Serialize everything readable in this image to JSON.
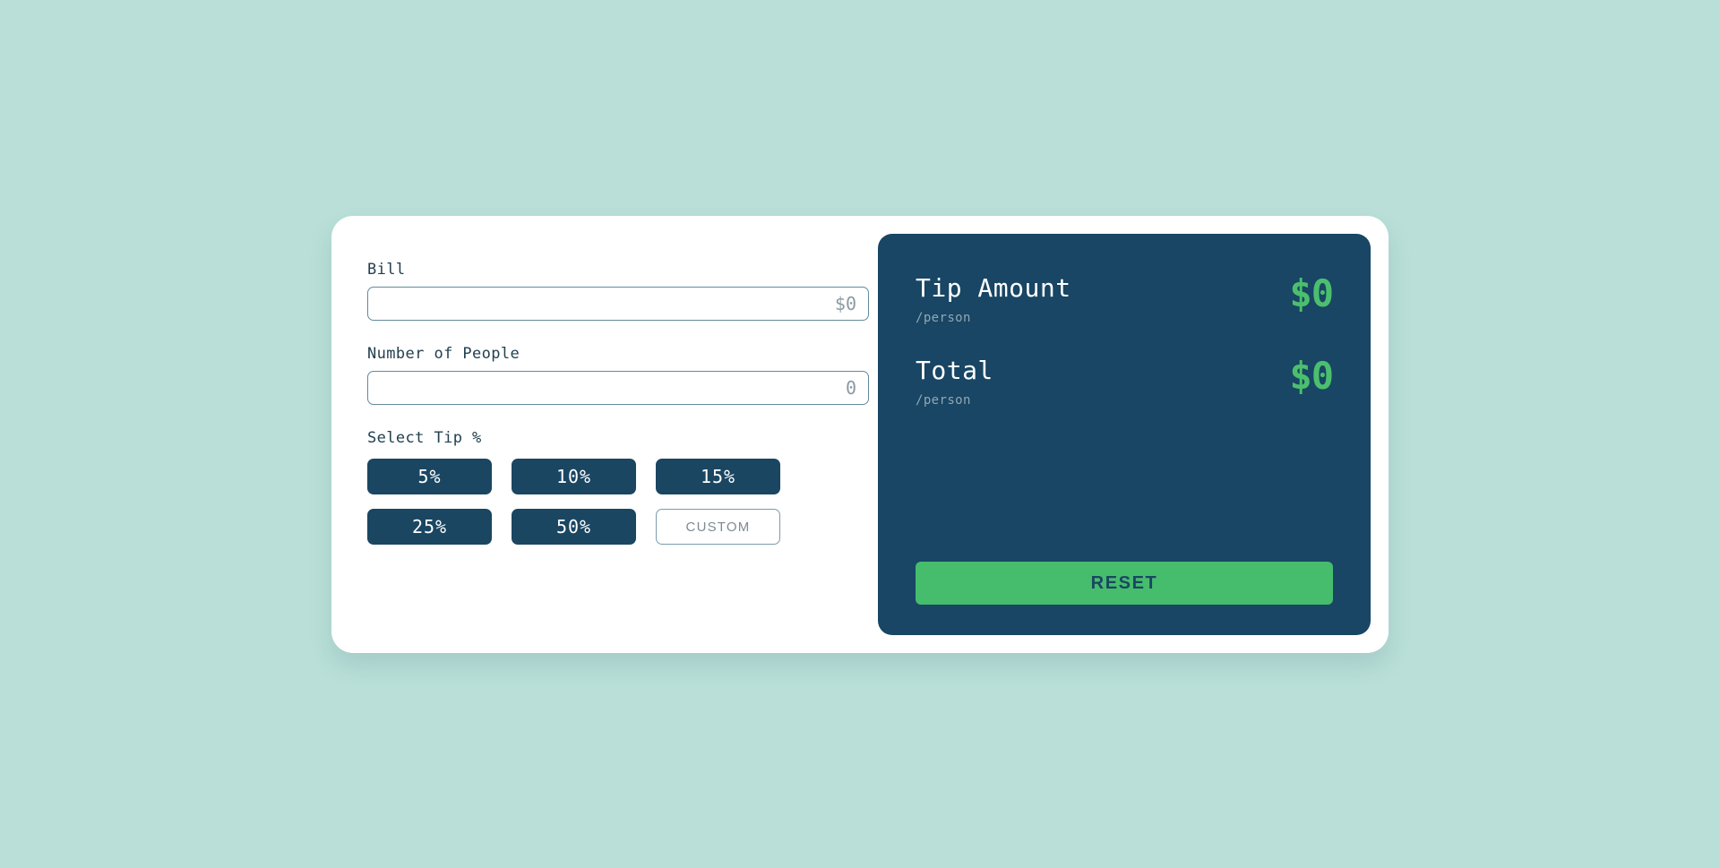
{
  "theme": {
    "page_background": "#b9dfd8",
    "card_background": "#ffffff",
    "panel_background": "#184664",
    "accent_green": "#4cbf6e",
    "reset_green": "#45bd6c",
    "tip_button_navy": "#1a4662",
    "input_border": "#628a9c",
    "muted_text": "#90a8b5"
  },
  "form": {
    "bill": {
      "label": "Bill",
      "value": "",
      "placeholder": "$0"
    },
    "people": {
      "label": "Number of People",
      "value": "",
      "placeholder": "0"
    },
    "tip": {
      "label": "Select Tip %",
      "options": [
        {
          "label": "5%",
          "name": "tip-option-5",
          "custom": false
        },
        {
          "label": "10%",
          "name": "tip-option-10",
          "custom": false
        },
        {
          "label": "15%",
          "name": "tip-option-15",
          "custom": false
        },
        {
          "label": "25%",
          "name": "tip-option-25",
          "custom": false
        },
        {
          "label": "50%",
          "name": "tip-option-50",
          "custom": false
        },
        {
          "label": "CUSTOM",
          "name": "tip-option-custom",
          "custom": true
        }
      ]
    }
  },
  "results": {
    "rows": [
      {
        "title": "Tip Amount",
        "subtitle": "/person",
        "value": "$0"
      },
      {
        "title": "Total",
        "subtitle": "/person",
        "value": "$0"
      }
    ],
    "reset_label": "RESET"
  }
}
